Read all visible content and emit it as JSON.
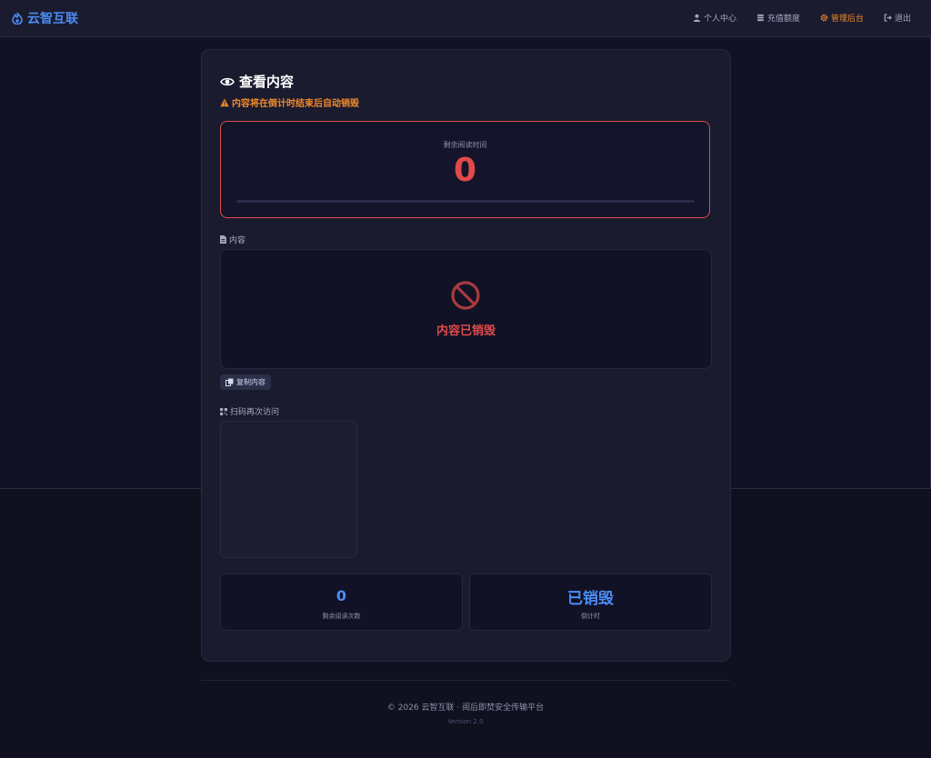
{
  "brand": {
    "name": "云智互联"
  },
  "nav": {
    "items": [
      {
        "label": "个人中心",
        "icon": "user-icon"
      },
      {
        "label": "充值额度",
        "icon": "coins-icon"
      },
      {
        "label": "管理后台",
        "icon": "gear-icon",
        "active": true
      },
      {
        "label": "退出",
        "icon": "logout-icon"
      }
    ]
  },
  "card": {
    "title": "查看内容",
    "warning": "内容将在倒计时结束后自动销毁",
    "timer": {
      "label": "剩余阅读时间",
      "value": "0",
      "progress": 0
    },
    "content_label": "内容",
    "destroyed_text": "内容已销毁",
    "copy_button": "复制内容",
    "qr_label": "扫码再次访问",
    "stats": [
      {
        "value": "0",
        "label": "剩余阅读次数"
      },
      {
        "value": "已销毁",
        "label": "倒计时"
      }
    ]
  },
  "footer": {
    "text": "© 2026 云智互联 · 阅后即焚安全传输平台",
    "version": "Version 2.0"
  },
  "colors": {
    "accent": "#4b8cf5",
    "danger": "#e24a4a",
    "warning": "#f08a2c"
  }
}
